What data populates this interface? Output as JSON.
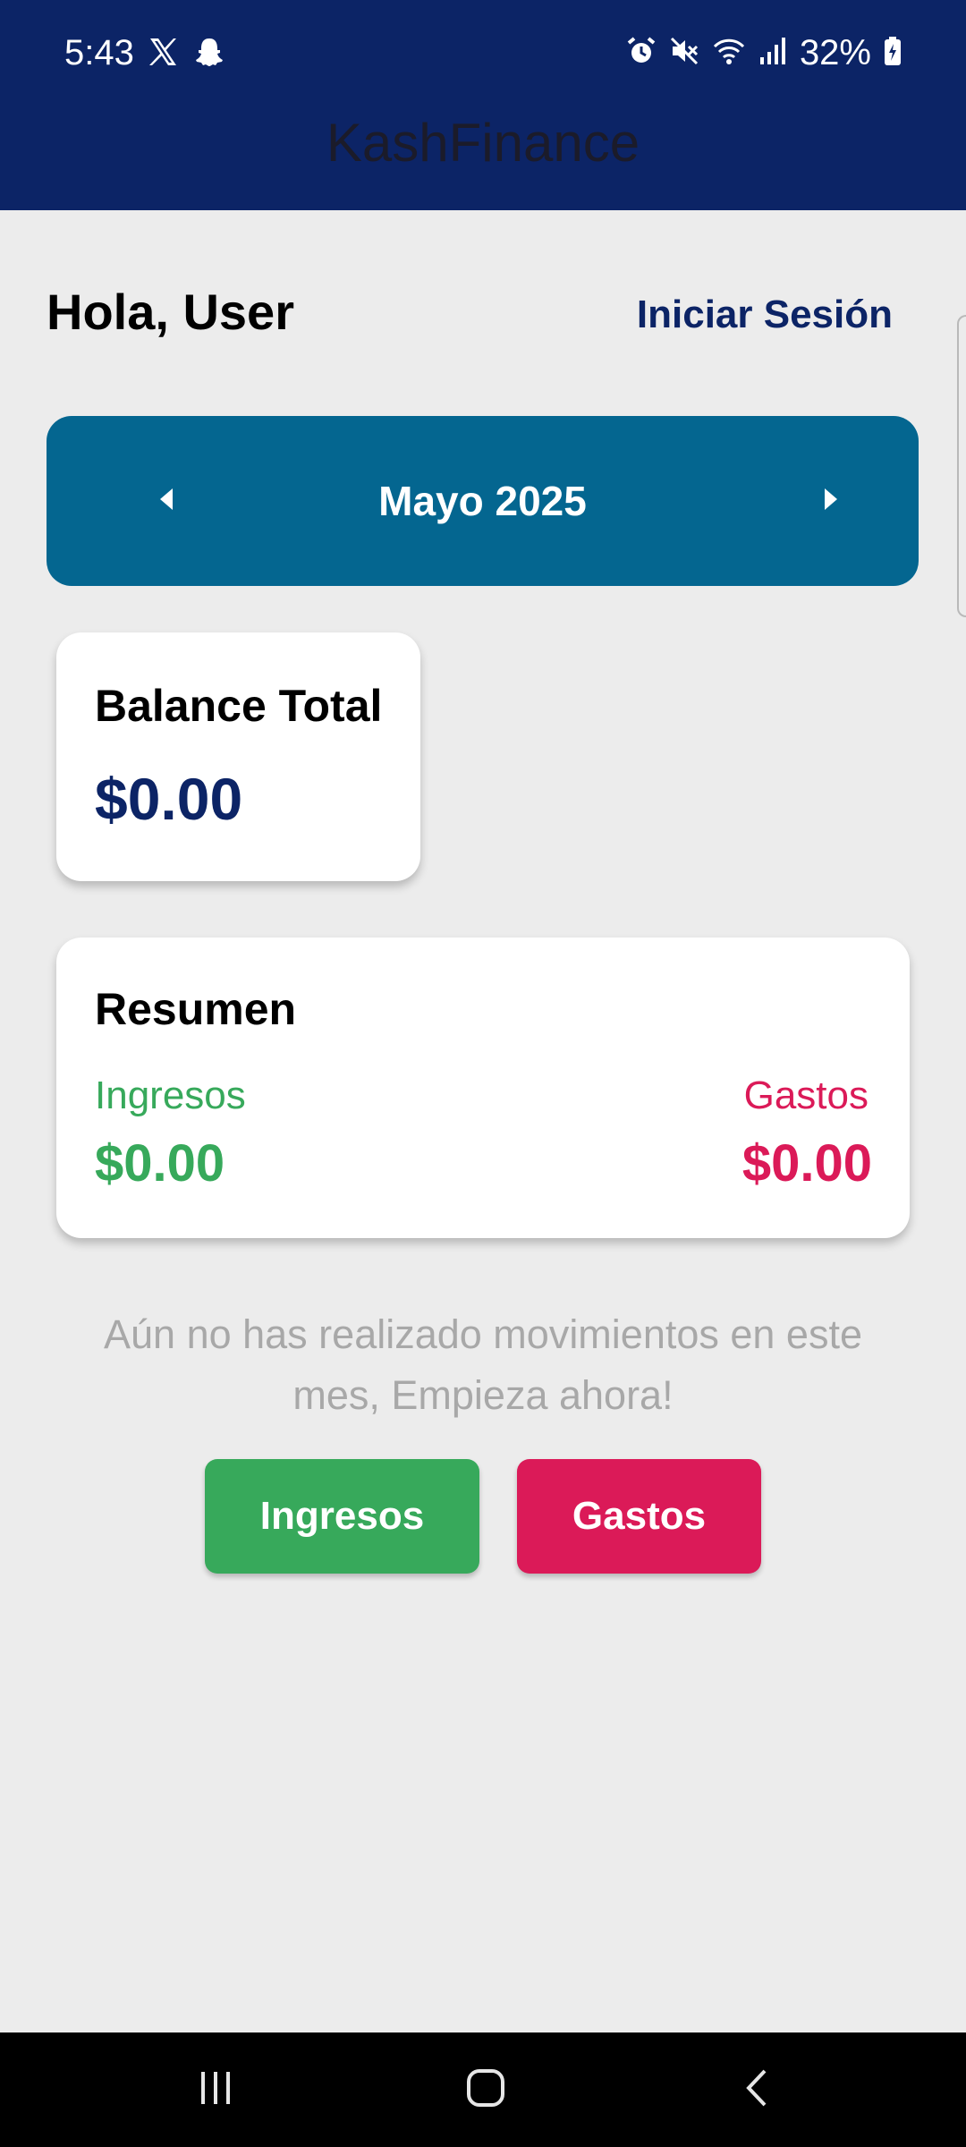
{
  "status_bar": {
    "time": "5:43",
    "left_icons": [
      "x-app-icon",
      "snapchat-icon"
    ],
    "right_icons": [
      "alarm-icon",
      "mute-icon",
      "wifi-icon",
      "signal-icon"
    ],
    "battery_percent": "32%",
    "battery_icon": "battery-charging-icon"
  },
  "app_bar": {
    "title": "KashFinance"
  },
  "greeting": {
    "text": "Hola, User",
    "login_label": "Iniciar Sesión"
  },
  "month_selector": {
    "label": "Mayo 2025",
    "prev_icon": "caret-left-icon",
    "next_icon": "caret-right-icon"
  },
  "balance": {
    "title": "Balance Total",
    "value": "$0.00"
  },
  "summary": {
    "title": "Resumen",
    "income_label": "Ingresos",
    "income_value": "$0.00",
    "expense_label": "Gastos",
    "expense_value": "$0.00"
  },
  "empty_state": {
    "message": "Aún no has realizado movimientos en este mes, Empieza ahora!"
  },
  "actions": {
    "income_button": "Ingresos",
    "expense_button": "Gastos"
  },
  "colors": {
    "header": "#0c2466",
    "month_bar": "#046690",
    "income": "#37a95b",
    "expense": "#db1a58",
    "background": "#ececec"
  },
  "nav_bar": {
    "buttons": [
      "recents-icon",
      "home-icon",
      "back-icon"
    ]
  }
}
